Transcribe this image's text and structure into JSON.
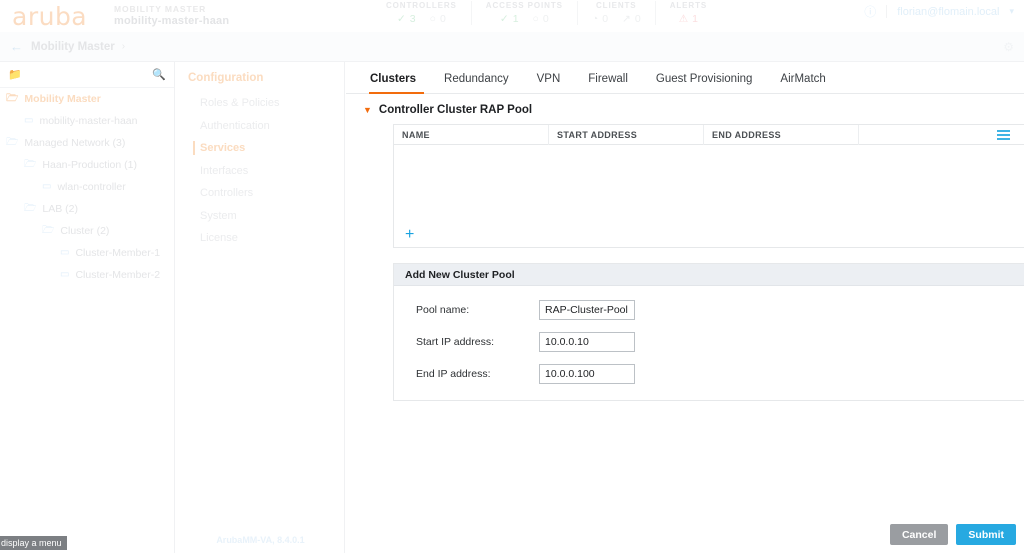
{
  "topbar": {
    "logo_text": "aruba",
    "device_type": "MOBILITY MASTER",
    "device_name": "mobility-master-haan",
    "help_icon": "help-circle-icon",
    "account_email": "florian@flomain.local",
    "account_chevron": "chevron-down-icon",
    "stats": [
      {
        "label": "CONTROLLERS",
        "items": [
          {
            "icon": "check-circle-icon",
            "glyph": "✓",
            "value": "3",
            "color": "#d7efdf"
          },
          {
            "icon": "dot-circle-icon",
            "glyph": "○",
            "value": "0",
            "color": "#eef0f1"
          }
        ]
      },
      {
        "label": "ACCESS POINTS",
        "items": [
          {
            "icon": "check-circle-icon",
            "glyph": "✓",
            "value": "1",
            "color": "#d7efdf"
          },
          {
            "icon": "dot-circle-icon",
            "glyph": "○",
            "value": "0",
            "color": "#eef0f1"
          }
        ]
      },
      {
        "label": "CLIENTS",
        "items": [
          {
            "icon": "wifi-icon",
            "glyph": "◔",
            "value": "0",
            "color": "#eef0f1"
          },
          {
            "icon": "wired-client-icon",
            "glyph": "↗",
            "value": "0",
            "color": "#eef0f1"
          }
        ]
      },
      {
        "label": "ALERTS",
        "items": [
          {
            "icon": "warning-triangle-icon",
            "glyph": "⚠",
            "value": "1",
            "color": "#fbdfe0"
          }
        ]
      }
    ]
  },
  "breadcrumb": {
    "back_icon": "arrow-left-icon",
    "label": "Mobility Master",
    "separator": "›",
    "gear_icon": "gear-icon"
  },
  "tree": {
    "search_folder_icon": "folder-cursor-icon",
    "search_icon": "search-icon",
    "nodes": [
      {
        "label": "Mobility Master",
        "icon": "folder-icon",
        "level": 0,
        "selected": true
      },
      {
        "label": "mobility-master-haan",
        "icon": "controller-icon",
        "level": 1,
        "selected": false
      },
      {
        "label": "Managed Network (3)",
        "icon": "folder-icon",
        "level": 0,
        "selected": false
      },
      {
        "label": "Haan-Production (1)",
        "icon": "folder-icon",
        "level": 2,
        "selected": false
      },
      {
        "label": "wlan-controller",
        "icon": "controller-icon",
        "level": 3,
        "selected": false
      },
      {
        "label": "LAB (2)",
        "icon": "folder-icon",
        "level": 2,
        "selected": false
      },
      {
        "label": "Cluster (2)",
        "icon": "folder-icon",
        "level": 3,
        "selected": false
      },
      {
        "label": "Cluster-Member-1",
        "icon": "controller-icon",
        "level": 4,
        "selected": false
      },
      {
        "label": "Cluster-Member-2",
        "icon": "controller-icon",
        "level": 4,
        "selected": false
      }
    ]
  },
  "config_menu": {
    "title": "Configuration",
    "items": [
      {
        "label": "Roles & Policies",
        "selected": false
      },
      {
        "label": "Authentication",
        "selected": false
      },
      {
        "label": "Services",
        "selected": true
      },
      {
        "label": "Interfaces",
        "selected": false
      },
      {
        "label": "Controllers",
        "selected": false
      },
      {
        "label": "System",
        "selected": false
      },
      {
        "label": "License",
        "selected": false
      }
    ],
    "version": "ArubaMM-VA, 8.4.0.1"
  },
  "main": {
    "tabs": [
      {
        "label": "Clusters",
        "active": true
      },
      {
        "label": "Redundancy",
        "active": false
      },
      {
        "label": "VPN",
        "active": false
      },
      {
        "label": "Firewall",
        "active": false
      },
      {
        "label": "Guest Provisioning",
        "active": false
      },
      {
        "label": "AirMatch",
        "active": false
      }
    ],
    "section": {
      "chevron_icon": "chevron-down-icon",
      "title": "Controller Cluster RAP Pool"
    },
    "table": {
      "columns": [
        "NAME",
        "START ADDRESS",
        "END ADDRESS"
      ],
      "rows": [],
      "menu_icon": "hamburger-menu-icon",
      "add_icon": "plus-icon",
      "add_label": "+"
    },
    "form": {
      "title": "Add New Cluster Pool",
      "fields": [
        {
          "label": "Pool name:",
          "value": "RAP-Cluster-Pool",
          "name": "pool-name"
        },
        {
          "label": "Start IP address:",
          "value": "10.0.0.10",
          "name": "start-ip"
        },
        {
          "label": "End IP address:",
          "value": "10.0.0.100",
          "name": "end-ip"
        }
      ]
    },
    "actions": {
      "cancel_label": "Cancel",
      "submit_label": "Submit"
    }
  },
  "tooltip": {
    "text": "display a menu"
  },
  "colors": {
    "accent_orange": "#f26c0d",
    "accent_blue": "#27a9e1",
    "cancel_grey": "#9a9da1"
  }
}
